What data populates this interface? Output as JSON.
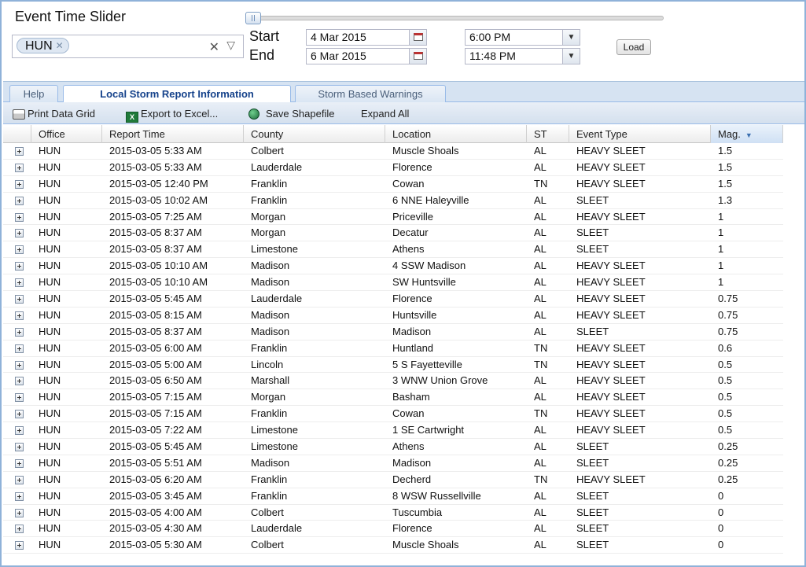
{
  "slider": {
    "title": "Event Time Slider",
    "selected_office": "HUN",
    "start_label": "Start",
    "end_label": "End",
    "start_date": "4 Mar 2015",
    "end_date": "6 Mar 2015",
    "start_time": "6:00 PM",
    "end_time": "11:48 PM",
    "load_label": "Load"
  },
  "tabs": [
    {
      "label": "Help",
      "active": false
    },
    {
      "label": "Local Storm Report Information",
      "active": true
    },
    {
      "label": "Storm Based Warnings",
      "active": false
    }
  ],
  "toolbar": {
    "print_label": "Print Data Grid",
    "excel_label": "Export to Excel...",
    "shapefile_label": "Save Shapefile",
    "expand_label": "Expand All"
  },
  "grid": {
    "columns": [
      "Office",
      "Report Time",
      "County",
      "Location",
      "ST",
      "Event Type",
      "Mag."
    ],
    "sort_column": "Mag.",
    "sort_direction": "descending",
    "rows": [
      [
        "HUN",
        "2015-03-05 5:33 AM",
        "Colbert",
        "Muscle Shoals",
        "AL",
        "HEAVY SLEET",
        "1.5"
      ],
      [
        "HUN",
        "2015-03-05 5:33 AM",
        "Lauderdale",
        "Florence",
        "AL",
        "HEAVY SLEET",
        "1.5"
      ],
      [
        "HUN",
        "2015-03-05 12:40 PM",
        "Franklin",
        "Cowan",
        "TN",
        "HEAVY SLEET",
        "1.5"
      ],
      [
        "HUN",
        "2015-03-05 10:02 AM",
        "Franklin",
        "6 NNE Haleyville",
        "AL",
        "SLEET",
        "1.3"
      ],
      [
        "HUN",
        "2015-03-05 7:25 AM",
        "Morgan",
        "Priceville",
        "AL",
        "HEAVY SLEET",
        "1"
      ],
      [
        "HUN",
        "2015-03-05 8:37 AM",
        "Morgan",
        "Decatur",
        "AL",
        "SLEET",
        "1"
      ],
      [
        "HUN",
        "2015-03-05 8:37 AM",
        "Limestone",
        "Athens",
        "AL",
        "SLEET",
        "1"
      ],
      [
        "HUN",
        "2015-03-05 10:10 AM",
        "Madison",
        "4 SSW Madison",
        "AL",
        "HEAVY SLEET",
        "1"
      ],
      [
        "HUN",
        "2015-03-05 10:10 AM",
        "Madison",
        "SW Huntsville",
        "AL",
        "HEAVY SLEET",
        "1"
      ],
      [
        "HUN",
        "2015-03-05 5:45 AM",
        "Lauderdale",
        "Florence",
        "AL",
        "HEAVY SLEET",
        "0.75"
      ],
      [
        "HUN",
        "2015-03-05 8:15 AM",
        "Madison",
        "Huntsville",
        "AL",
        "HEAVY SLEET",
        "0.75"
      ],
      [
        "HUN",
        "2015-03-05 8:37 AM",
        "Madison",
        "Madison",
        "AL",
        "SLEET",
        "0.75"
      ],
      [
        "HUN",
        "2015-03-05 6:00 AM",
        "Franklin",
        "Huntland",
        "TN",
        "HEAVY SLEET",
        "0.6"
      ],
      [
        "HUN",
        "2015-03-05 5:00 AM",
        "Lincoln",
        "5 S Fayetteville",
        "TN",
        "HEAVY SLEET",
        "0.5"
      ],
      [
        "HUN",
        "2015-03-05 6:50 AM",
        "Marshall",
        "3 WNW Union Grove",
        "AL",
        "HEAVY SLEET",
        "0.5"
      ],
      [
        "HUN",
        "2015-03-05 7:15 AM",
        "Morgan",
        "Basham",
        "AL",
        "HEAVY SLEET",
        "0.5"
      ],
      [
        "HUN",
        "2015-03-05 7:15 AM",
        "Franklin",
        "Cowan",
        "TN",
        "HEAVY SLEET",
        "0.5"
      ],
      [
        "HUN",
        "2015-03-05 7:22 AM",
        "Limestone",
        "1 SE Cartwright",
        "AL",
        "HEAVY SLEET",
        "0.5"
      ],
      [
        "HUN",
        "2015-03-05 5:45 AM",
        "Limestone",
        "Athens",
        "AL",
        "SLEET",
        "0.25"
      ],
      [
        "HUN",
        "2015-03-05 5:51 AM",
        "Madison",
        "Madison",
        "AL",
        "SLEET",
        "0.25"
      ],
      [
        "HUN",
        "2015-03-05 6:20 AM",
        "Franklin",
        "Decherd",
        "TN",
        "HEAVY SLEET",
        "0.25"
      ],
      [
        "HUN",
        "2015-03-05 3:45 AM",
        "Franklin",
        "8 WSW Russellville",
        "AL",
        "SLEET",
        "0"
      ],
      [
        "HUN",
        "2015-03-05 4:00 AM",
        "Colbert",
        "Tuscumbia",
        "AL",
        "SLEET",
        "0"
      ],
      [
        "HUN",
        "2015-03-05 4:30 AM",
        "Lauderdale",
        "Florence",
        "AL",
        "SLEET",
        "0"
      ],
      [
        "HUN",
        "2015-03-05 5:30 AM",
        "Colbert",
        "Muscle Shoals",
        "AL",
        "SLEET",
        "0"
      ]
    ]
  },
  "icons": {
    "print": "printer-icon",
    "excel": "excel-icon",
    "shapefile": "globe-icon",
    "expander": "plus-box-icon",
    "calendar": "calendar-icon"
  },
  "colors": {
    "tab_active_text": "#15428b",
    "header_border": "#99bbe8",
    "sort_highlight": "#cfe0f4"
  }
}
